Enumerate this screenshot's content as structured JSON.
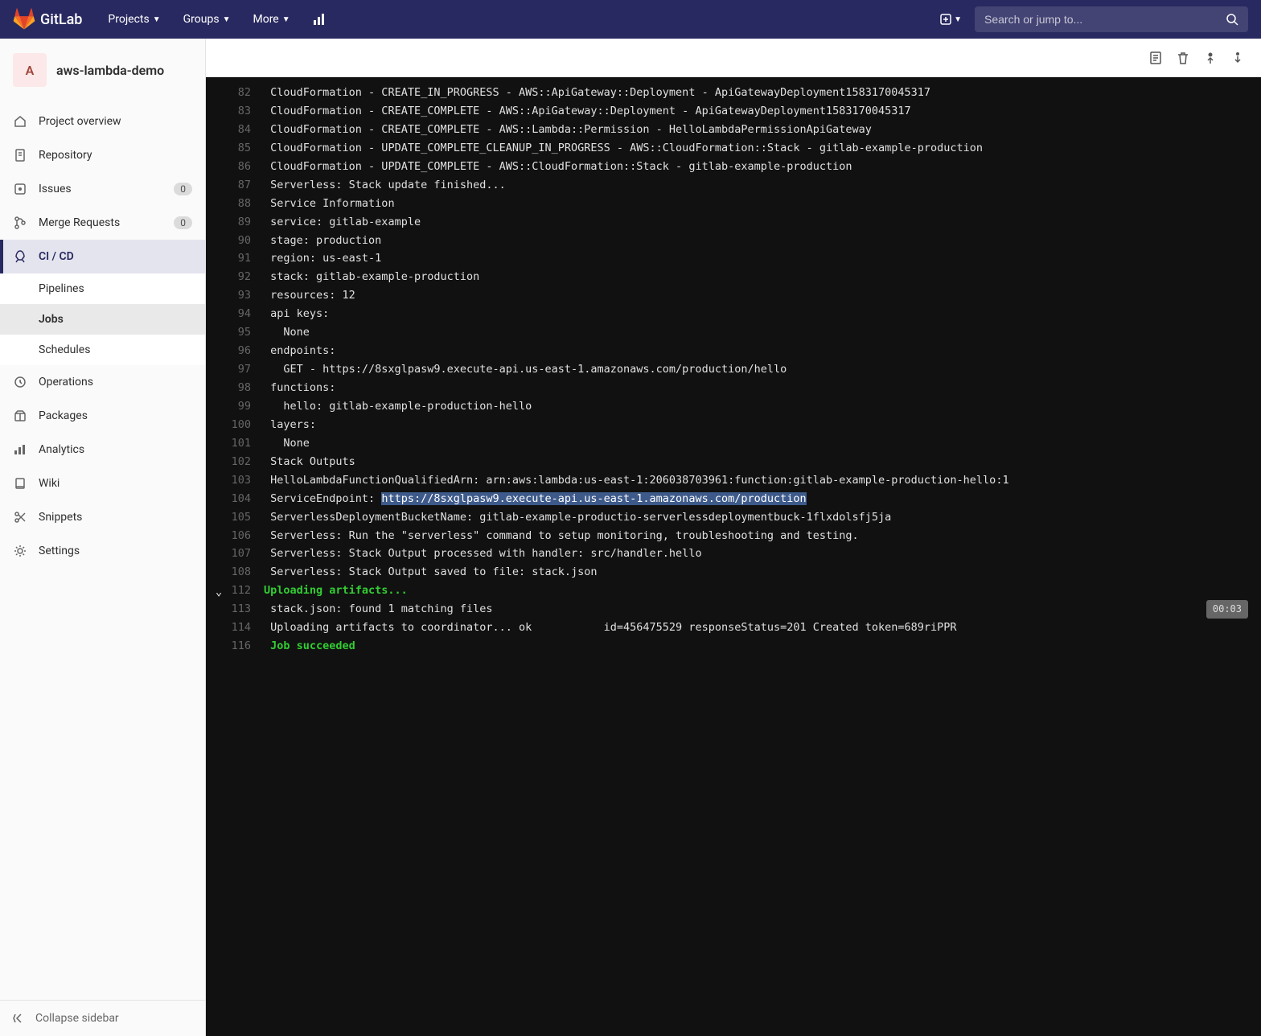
{
  "nav": {
    "brand": "GitLab",
    "items": [
      "Projects",
      "Groups",
      "More"
    ],
    "search_placeholder": "Search or jump to..."
  },
  "project": {
    "avatar_letter": "A",
    "name": "aws-lambda-demo"
  },
  "sidebar": {
    "items": [
      {
        "label": "Project overview",
        "icon": "home"
      },
      {
        "label": "Repository",
        "icon": "doc"
      },
      {
        "label": "Issues",
        "icon": "issues",
        "badge": "0"
      },
      {
        "label": "Merge Requests",
        "icon": "merge",
        "badge": "0"
      },
      {
        "label": "CI / CD",
        "icon": "rocket",
        "active": true,
        "sub": [
          {
            "label": "Pipelines"
          },
          {
            "label": "Jobs",
            "active": true
          },
          {
            "label": "Schedules"
          }
        ]
      },
      {
        "label": "Operations",
        "icon": "ops"
      },
      {
        "label": "Packages",
        "icon": "package"
      },
      {
        "label": "Analytics",
        "icon": "chart"
      },
      {
        "label": "Wiki",
        "icon": "book"
      },
      {
        "label": "Snippets",
        "icon": "snip"
      },
      {
        "label": "Settings",
        "icon": "gear"
      }
    ],
    "collapse": "Collapse sidebar"
  },
  "timer": "00:03",
  "console": [
    {
      "n": "82",
      "t": " CloudFormation - CREATE_IN_PROGRESS - AWS::ApiGateway::Deployment - ApiGatewayDeployment1583170045317"
    },
    {
      "n": "83",
      "t": " CloudFormation - CREATE_COMPLETE - AWS::ApiGateway::Deployment - ApiGatewayDeployment1583170045317"
    },
    {
      "n": "84",
      "t": " CloudFormation - CREATE_COMPLETE - AWS::Lambda::Permission - HelloLambdaPermissionApiGateway"
    },
    {
      "n": "85",
      "t": " CloudFormation - UPDATE_COMPLETE_CLEANUP_IN_PROGRESS - AWS::CloudFormation::Stack - gitlab-example-production"
    },
    {
      "n": "86",
      "t": " CloudFormation - UPDATE_COMPLETE - AWS::CloudFormation::Stack - gitlab-example-production"
    },
    {
      "n": "87",
      "t": " Serverless: Stack update finished..."
    },
    {
      "n": "88",
      "t": " Service Information"
    },
    {
      "n": "89",
      "t": " service: gitlab-example"
    },
    {
      "n": "90",
      "t": " stage: production"
    },
    {
      "n": "91",
      "t": " region: us-east-1"
    },
    {
      "n": "92",
      "t": " stack: gitlab-example-production"
    },
    {
      "n": "93",
      "t": " resources: 12"
    },
    {
      "n": "94",
      "t": " api keys:"
    },
    {
      "n": "95",
      "t": "   None"
    },
    {
      "n": "96",
      "t": " endpoints:"
    },
    {
      "n": "97",
      "t": "   GET - https://8sxglpasw9.execute-api.us-east-1.amazonaws.com/production/hello"
    },
    {
      "n": "98",
      "t": " functions:"
    },
    {
      "n": "99",
      "t": "   hello: gitlab-example-production-hello"
    },
    {
      "n": "100",
      "t": " layers:"
    },
    {
      "n": "101",
      "t": "   None"
    },
    {
      "n": "102",
      "t": " Stack Outputs"
    },
    {
      "n": "103",
      "t": " HelloLambdaFunctionQualifiedArn: arn:aws:lambda:us-east-1:206038703961:function:gitlab-example-production-hello:1"
    },
    {
      "n": "104",
      "t": " ServiceEndpoint: ",
      "hl": "https://8sxglpasw9.execute-api.us-east-1.amazonaws.com/production"
    },
    {
      "n": "105",
      "t": " ServerlessDeploymentBucketName: gitlab-example-productio-serverlessdeploymentbuck-1flxdolsfj5ja"
    },
    {
      "n": "106",
      "t": " Serverless: Run the \"serverless\" command to setup monitoring, troubleshooting and testing."
    },
    {
      "n": "107",
      "t": " Serverless: Stack Output processed with handler: src/handler.hello"
    },
    {
      "n": "108",
      "t": " Serverless: Stack Output saved to file: stack.json"
    },
    {
      "n": "112",
      "t": "Uploading artifacts...",
      "green": true,
      "chev": true,
      "timer": true
    },
    {
      "n": "113",
      "t": " stack.json: found 1 matching files"
    },
    {
      "n": "114",
      "t": " Uploading artifacts to coordinator... ok           id=456475529 responseStatus=201 Created token=689riPPR"
    },
    {
      "n": "116",
      "t": " Job succeeded",
      "green": true
    }
  ]
}
